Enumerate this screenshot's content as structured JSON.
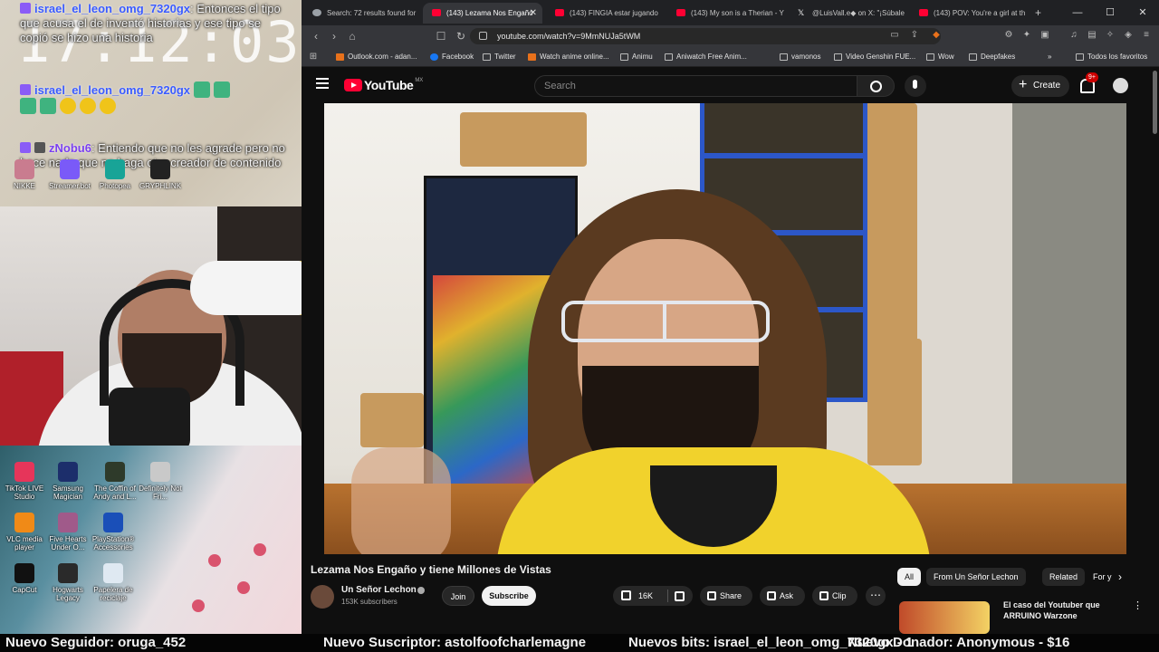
{
  "overlay": {
    "clock": "17:12:03",
    "chat": [
      {
        "user": "israel_el_leon_omg_7320gx",
        "text": ": Entonces el tipo que acusa el de inventó historias y ese tipo se copió se hizo una historia"
      },
      {
        "user": "israel_el_leon_omg_7320gx",
        "text": ""
      },
      {
        "user": "zNobu6",
        "text": ": Entiendo que no les agrade pero no hace nada que no haga otro creador de contenido"
      }
    ]
  },
  "desktop_icons_top": [
    "NIKKE",
    "Streamer.bot",
    "Photopea",
    "GRYPHLINK"
  ],
  "desktop_icons": [
    {
      "label": "TikTok LIVE Studio",
      "color": "#e6355a"
    },
    {
      "label": "Samsung Magician",
      "color": "#1c2e6b"
    },
    {
      "label": "The Coffin of Andy and L...",
      "color": "#2e3a2a"
    },
    {
      "label": "Definitely Not Fri...",
      "color": "#c9c9c9"
    },
    {
      "label": "VLC media player",
      "color": "#f08a17"
    },
    {
      "label": "Five Hearts Under O...",
      "color": "#a05a8a"
    },
    {
      "label": "PlayStation® Accessories",
      "color": "#1a4fb8"
    },
    {
      "label": "CapCut",
      "color": "#111111"
    },
    {
      "label": "Hogwarts Legacy",
      "color": "#2a2a2a"
    },
    {
      "label": "Papelera de reciclaje",
      "color": "#dfe9f2"
    }
  ],
  "browser": {
    "tabs": [
      {
        "label": "Search: 72 results found for",
        "icon": "gray",
        "active": false
      },
      {
        "label": "(143) Lezama Nos Engañó",
        "icon": "yt",
        "active": true
      },
      {
        "label": "(143) FINGIA estar jugando",
        "icon": "yt",
        "active": false
      },
      {
        "label": "(143) My son is a Therian - Y",
        "icon": "yt",
        "active": false
      },
      {
        "label": "@LuisVall.e◆ on X: \"¡Súbale",
        "icon": "x",
        "active": false
      },
      {
        "label": "(143) POV: You're a girl at th",
        "icon": "yt",
        "active": false
      }
    ],
    "url": "youtube.com/watch?v=9MmNUJa5tWM",
    "bookmarks": [
      "Outlook.com - adan...",
      "Facebook",
      "Twitter",
      "Watch anime online...",
      "Animu",
      "Aniwatch Free Anim...",
      "vamonos",
      "Video Genshin FUE...",
      "Wow",
      "Deepfakes",
      "Todos los favoritos"
    ]
  },
  "youtube": {
    "logo": "YouTube",
    "country": "MX",
    "search_placeholder": "Search",
    "create_label": "Create",
    "notif_count": "9+",
    "video_title": "Lezama Nos Engaño y tiene Millones de Vistas",
    "channel": "Un Señor Lechon",
    "subscribers": "153K subscribers",
    "join": "Join",
    "subscribe": "Subscribe",
    "likes": "16K",
    "share": "Share",
    "ask": "Ask",
    "clip": "Clip",
    "chips": [
      "All",
      "From Un Señor Lechon",
      "Related",
      "For y"
    ],
    "rec_title": "El caso del Youtuber que ARRUINO Warzone"
  },
  "ticker": {
    "follower": "Nuevo Seguidor: oruga_452",
    "subscriber": "Nuevo Suscriptor: astolfoofcharlemagne",
    "bits": "Nuevos bits: israel_el_leon_omg_7320gx - 1",
    "donor": "Nuevo Donador: Anonymous - $16"
  }
}
